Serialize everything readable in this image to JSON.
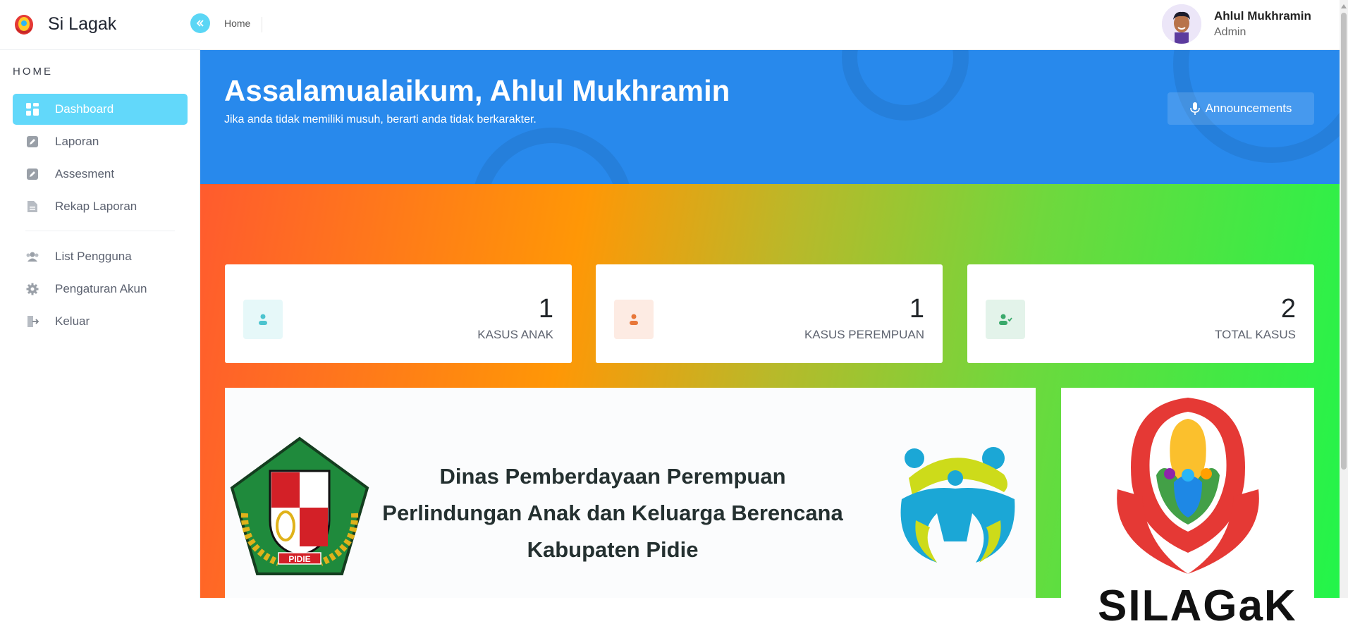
{
  "app": {
    "name": "Si Lagak"
  },
  "header": {
    "breadcrumb": "Home",
    "user_name": "Ahlul Mukhramin",
    "user_role": "Admin"
  },
  "sidebar": {
    "section": "HOME",
    "items": [
      {
        "label": "Dashboard",
        "icon": "dashboard-icon",
        "active": true
      },
      {
        "label": "Laporan",
        "icon": "edit-icon"
      },
      {
        "label": "Assesment",
        "icon": "edit-icon"
      },
      {
        "label": "Rekap Laporan",
        "icon": "document-icon"
      }
    ],
    "items2": [
      {
        "label": "List Pengguna",
        "icon": "users-icon"
      },
      {
        "label": "Pengaturan Akun",
        "icon": "gear-icon"
      },
      {
        "label": "Keluar",
        "icon": "logout-icon"
      }
    ]
  },
  "banner": {
    "greeting": "Assalamualaikum, Ahlul Mukhramin",
    "quote": "Jika anda tidak memiliki musuh, berarti anda tidak berkarakter.",
    "announce_label": "Announcements"
  },
  "stats": [
    {
      "value": "1",
      "label": "KASUS ANAK",
      "color": "#4cc4cf",
      "bg": "#e6f8f9"
    },
    {
      "value": "1",
      "label": "KASUS PEREMPUAN",
      "color": "#e8773a",
      "bg": "#fdebe3"
    },
    {
      "value": "2",
      "label": "TOTAL KASUS",
      "color": "#3aa96b",
      "bg": "#e3f3ea"
    }
  ],
  "institution": {
    "line1": "Dinas Pemberdayaan Perempuan",
    "line2": "Perlindungan Anak dan Keluarga Berencana",
    "line3": "Kabupaten Pidie",
    "emblem_text": "PIDIE"
  },
  "logo_text": "SILAGaK",
  "colors": {
    "accent": "#62d8fa",
    "banner": "#2889ec"
  }
}
